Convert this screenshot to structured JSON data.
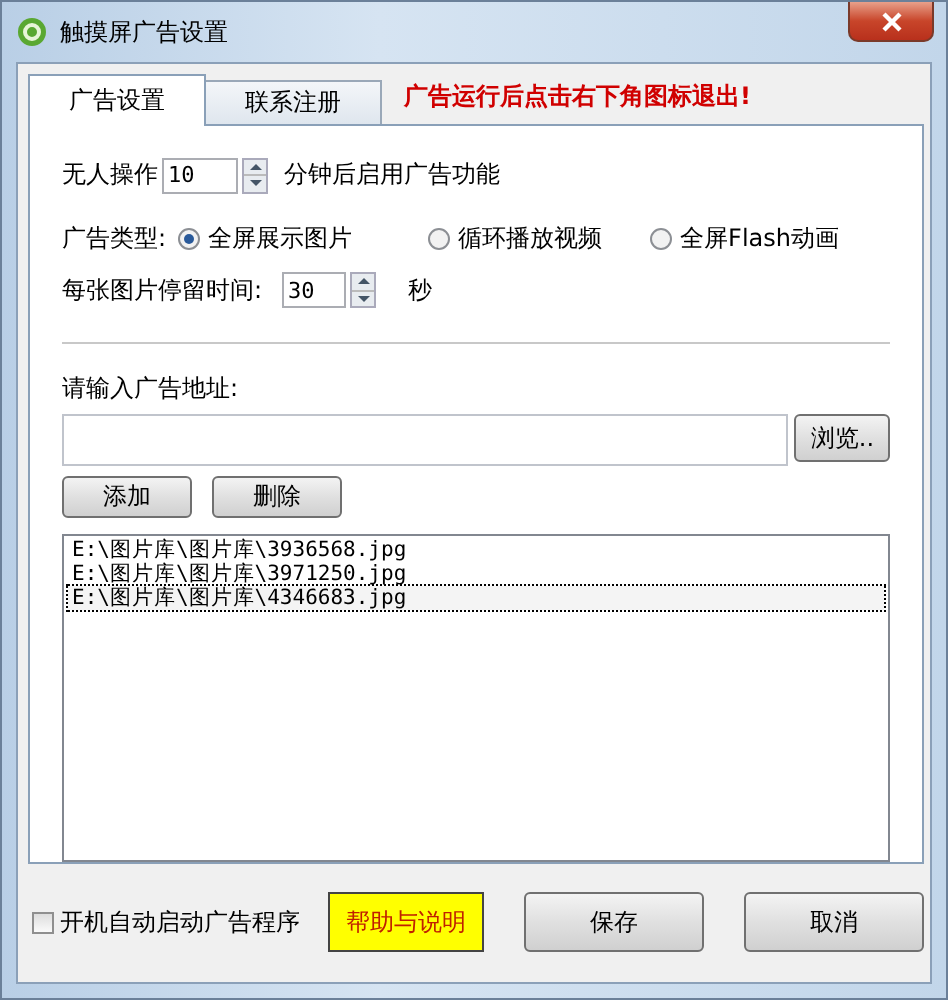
{
  "window": {
    "title": "触摸屏广告设置"
  },
  "tabs": [
    {
      "label": "广告设置",
      "selected": true
    },
    {
      "label": "联系注册",
      "selected": false
    }
  ],
  "notice": "广告运行后点击右下角图标退出!",
  "idle": {
    "label": "无人操作",
    "value": "10",
    "suffix": "分钟后启用广告功能"
  },
  "ad_type": {
    "label": "广告类型:",
    "options": [
      {
        "label": "全屏展示图片",
        "selected": true
      },
      {
        "label": "循环播放视频",
        "selected": false
      },
      {
        "label": "全屏Flash动画",
        "selected": false
      }
    ]
  },
  "interval": {
    "label": "每张图片停留时间:",
    "value": "30",
    "suffix": "秒"
  },
  "address": {
    "label": "请输入广告地址:",
    "browse": "浏览.."
  },
  "list_buttons": [
    "添加",
    "删除"
  ],
  "files": [
    {
      "path": "E:\\图片库\\图片库\\3936568.jpg",
      "selected": false
    },
    {
      "path": "E:\\图片库\\图片库\\3971250.jpg",
      "selected": false
    },
    {
      "path": "E:\\图片库\\图片库\\4346683.jpg",
      "selected": true
    }
  ],
  "autostart": {
    "label": "开机自动启动广告程序",
    "checked": false
  },
  "buttons": [
    {
      "label": "帮助与说明",
      "kind": "help"
    },
    {
      "label": "保存",
      "kind": "normal"
    },
    {
      "label": "取消",
      "kind": "normal"
    }
  ]
}
